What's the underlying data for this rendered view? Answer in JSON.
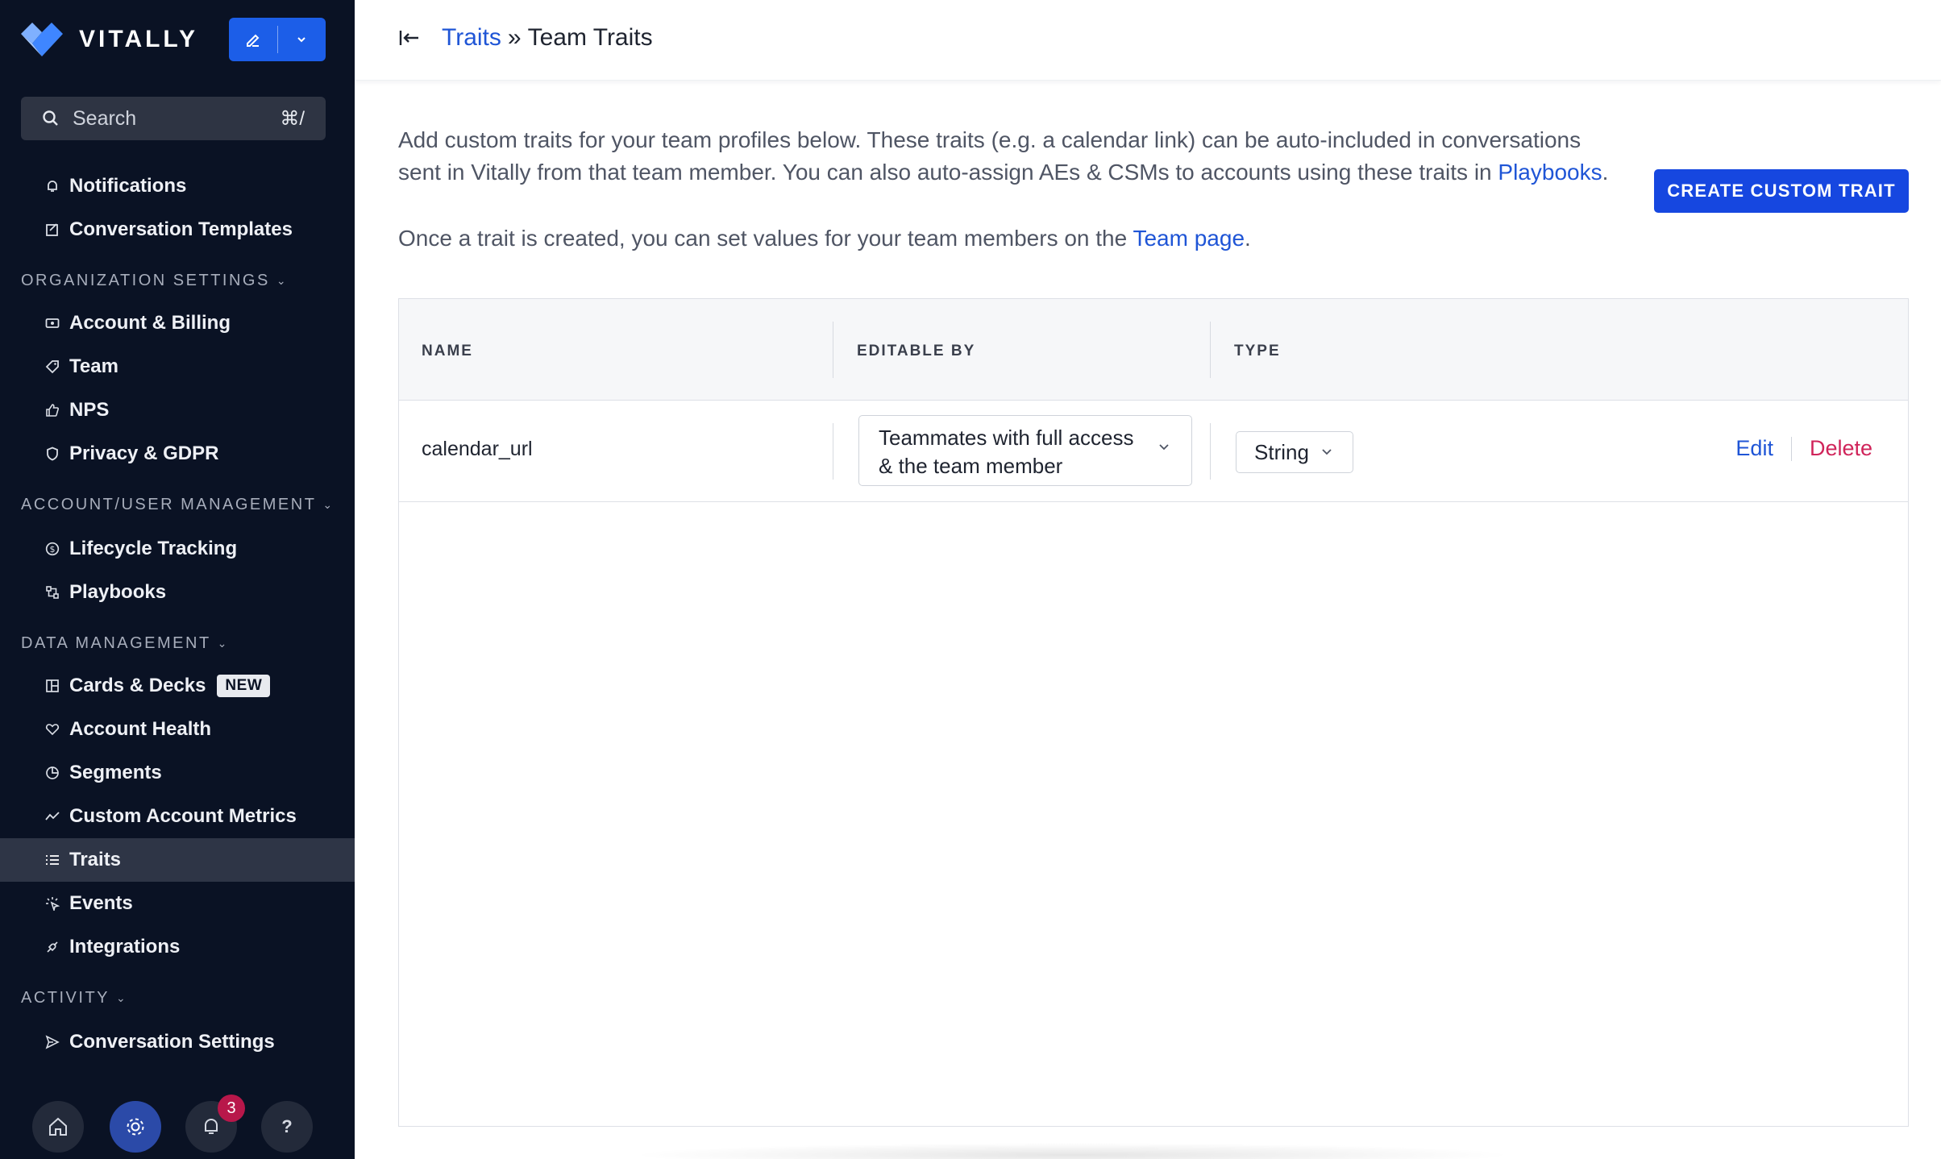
{
  "brand": {
    "name": "VITALLY",
    "accent": "#1c5ee8"
  },
  "search": {
    "placeholder": "Search",
    "shortcut": "⌘/"
  },
  "sidebar": {
    "items_top": [
      {
        "label": "Notifications",
        "icon": "bell-icon"
      },
      {
        "label": "Conversation Templates",
        "icon": "template-icon"
      }
    ],
    "sections": {
      "organization": "ORGANIZATION SETTINGS",
      "account_user": "ACCOUNT/USER MANAGEMENT",
      "data": "DATA MANAGEMENT",
      "activity": "ACTIVITY"
    },
    "org_items": [
      {
        "label": "Account & Billing",
        "icon": "billing-icon"
      },
      {
        "label": "Team",
        "icon": "tag-icon"
      },
      {
        "label": "NPS",
        "icon": "thumbs-up-icon"
      },
      {
        "label": "Privacy & GDPR",
        "icon": "shield-icon"
      }
    ],
    "account_items": [
      {
        "label": "Lifecycle Tracking",
        "icon": "dollar-icon"
      },
      {
        "label": "Playbooks",
        "icon": "playbook-icon"
      }
    ],
    "data_items": [
      {
        "label": "Cards & Decks",
        "icon": "cards-icon",
        "badge": "NEW"
      },
      {
        "label": "Account Health",
        "icon": "health-icon"
      },
      {
        "label": "Segments",
        "icon": "pie-icon"
      },
      {
        "label": "Custom Account Metrics",
        "icon": "trend-icon"
      },
      {
        "label": "Traits",
        "icon": "list-icon",
        "active": true
      },
      {
        "label": "Events",
        "icon": "events-icon"
      },
      {
        "label": "Integrations",
        "icon": "plug-icon"
      }
    ],
    "activity_items": [
      {
        "label": "Conversation Settings",
        "icon": "send-icon"
      }
    ],
    "notifications_count": "3",
    "help": "?"
  },
  "header": {
    "breadcrumb_link": "Traits",
    "breadcrumb_sep": "»",
    "breadcrumb_current": "Team Traits"
  },
  "intro": {
    "p1": "Add custom traits for your team profiles below. These traits (e.g. a calendar link) can be auto-included in conversations sent in Vitally from that team member. You can also auto-assign AEs & CSMs to accounts using these traits in ",
    "p1_link": "Playbooks",
    "p1_end": ".",
    "p2": "Once a trait is created, you can set values for your team members on the ",
    "p2_link": "Team page",
    "p2_end": "."
  },
  "create_button": "CREATE CUSTOM TRAIT",
  "table": {
    "columns": [
      "NAME",
      "EDITABLE BY",
      "TYPE"
    ],
    "rows": [
      {
        "name": "calendar_url",
        "editable_by": "Teammates with full access & the team member",
        "type": "String",
        "edit": "Edit",
        "delete": "Delete"
      }
    ]
  }
}
